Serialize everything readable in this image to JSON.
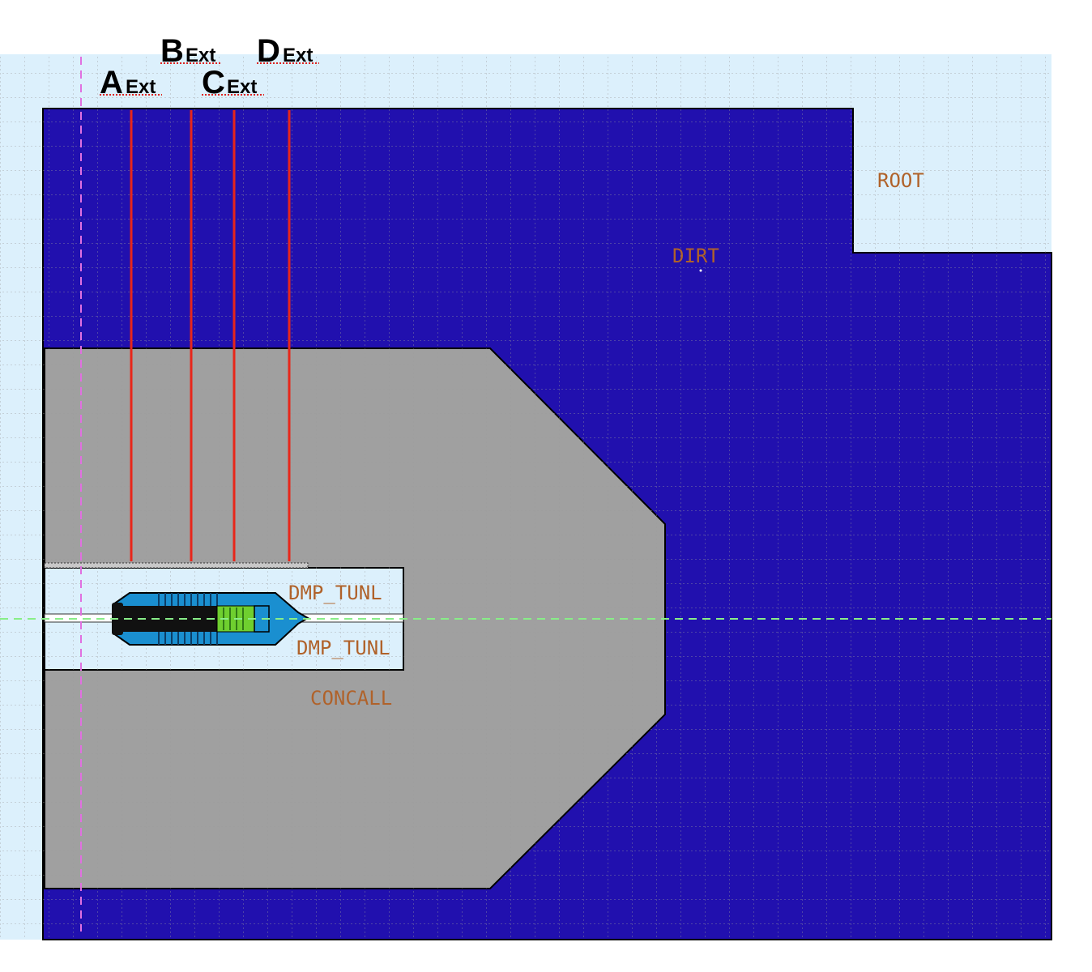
{
  "colors": {
    "background_air": "#dcf0fc",
    "dirt": "#2110ae",
    "concrete": "#a0a0a0",
    "tunnel": "#dcf0fc",
    "grid": "#9a9a9a",
    "label": "#b0622a",
    "red_line": "#e8261a",
    "beam_axis": "#88ee88",
    "vertical_axis": "#e070e0",
    "dump_blue": "#1a8fd0",
    "dump_core": "#111111",
    "dump_green": "#6fcf2f",
    "underline": "#dd2222"
  },
  "regions": {
    "root": "ROOT",
    "dirt": "DIRT",
    "tunnel_upper": "DMP_TUNL",
    "tunnel_lower": "DMP_TUNL",
    "concrete": "CONCALL"
  },
  "extraction_points": [
    {
      "letter": "A",
      "sub": "Ext"
    },
    {
      "letter": "B",
      "sub": "Ext"
    },
    {
      "letter": "C",
      "sub": "Ext"
    },
    {
      "letter": "D",
      "sub": "Ext"
    }
  ]
}
